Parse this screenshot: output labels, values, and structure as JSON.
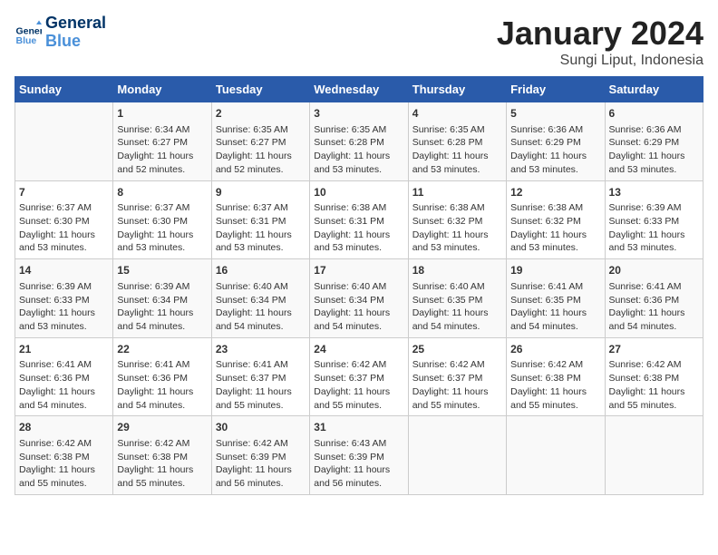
{
  "header": {
    "logo_line1": "General",
    "logo_line2": "Blue",
    "title": "January 2024",
    "subtitle": "Sungi Liput, Indonesia"
  },
  "days_of_week": [
    "Sunday",
    "Monday",
    "Tuesday",
    "Wednesday",
    "Thursday",
    "Friday",
    "Saturday"
  ],
  "weeks": [
    [
      {
        "day": "",
        "content": ""
      },
      {
        "day": "1",
        "content": "Sunrise: 6:34 AM\nSunset: 6:27 PM\nDaylight: 11 hours\nand 52 minutes."
      },
      {
        "day": "2",
        "content": "Sunrise: 6:35 AM\nSunset: 6:27 PM\nDaylight: 11 hours\nand 52 minutes."
      },
      {
        "day": "3",
        "content": "Sunrise: 6:35 AM\nSunset: 6:28 PM\nDaylight: 11 hours\nand 53 minutes."
      },
      {
        "day": "4",
        "content": "Sunrise: 6:35 AM\nSunset: 6:28 PM\nDaylight: 11 hours\nand 53 minutes."
      },
      {
        "day": "5",
        "content": "Sunrise: 6:36 AM\nSunset: 6:29 PM\nDaylight: 11 hours\nand 53 minutes."
      },
      {
        "day": "6",
        "content": "Sunrise: 6:36 AM\nSunset: 6:29 PM\nDaylight: 11 hours\nand 53 minutes."
      }
    ],
    [
      {
        "day": "7",
        "content": "Sunrise: 6:37 AM\nSunset: 6:30 PM\nDaylight: 11 hours\nand 53 minutes."
      },
      {
        "day": "8",
        "content": "Sunrise: 6:37 AM\nSunset: 6:30 PM\nDaylight: 11 hours\nand 53 minutes."
      },
      {
        "day": "9",
        "content": "Sunrise: 6:37 AM\nSunset: 6:31 PM\nDaylight: 11 hours\nand 53 minutes."
      },
      {
        "day": "10",
        "content": "Sunrise: 6:38 AM\nSunset: 6:31 PM\nDaylight: 11 hours\nand 53 minutes."
      },
      {
        "day": "11",
        "content": "Sunrise: 6:38 AM\nSunset: 6:32 PM\nDaylight: 11 hours\nand 53 minutes."
      },
      {
        "day": "12",
        "content": "Sunrise: 6:38 AM\nSunset: 6:32 PM\nDaylight: 11 hours\nand 53 minutes."
      },
      {
        "day": "13",
        "content": "Sunrise: 6:39 AM\nSunset: 6:33 PM\nDaylight: 11 hours\nand 53 minutes."
      }
    ],
    [
      {
        "day": "14",
        "content": "Sunrise: 6:39 AM\nSunset: 6:33 PM\nDaylight: 11 hours\nand 53 minutes."
      },
      {
        "day": "15",
        "content": "Sunrise: 6:39 AM\nSunset: 6:34 PM\nDaylight: 11 hours\nand 54 minutes."
      },
      {
        "day": "16",
        "content": "Sunrise: 6:40 AM\nSunset: 6:34 PM\nDaylight: 11 hours\nand 54 minutes."
      },
      {
        "day": "17",
        "content": "Sunrise: 6:40 AM\nSunset: 6:34 PM\nDaylight: 11 hours\nand 54 minutes."
      },
      {
        "day": "18",
        "content": "Sunrise: 6:40 AM\nSunset: 6:35 PM\nDaylight: 11 hours\nand 54 minutes."
      },
      {
        "day": "19",
        "content": "Sunrise: 6:41 AM\nSunset: 6:35 PM\nDaylight: 11 hours\nand 54 minutes."
      },
      {
        "day": "20",
        "content": "Sunrise: 6:41 AM\nSunset: 6:36 PM\nDaylight: 11 hours\nand 54 minutes."
      }
    ],
    [
      {
        "day": "21",
        "content": "Sunrise: 6:41 AM\nSunset: 6:36 PM\nDaylight: 11 hours\nand 54 minutes."
      },
      {
        "day": "22",
        "content": "Sunrise: 6:41 AM\nSunset: 6:36 PM\nDaylight: 11 hours\nand 54 minutes."
      },
      {
        "day": "23",
        "content": "Sunrise: 6:41 AM\nSunset: 6:37 PM\nDaylight: 11 hours\nand 55 minutes."
      },
      {
        "day": "24",
        "content": "Sunrise: 6:42 AM\nSunset: 6:37 PM\nDaylight: 11 hours\nand 55 minutes."
      },
      {
        "day": "25",
        "content": "Sunrise: 6:42 AM\nSunset: 6:37 PM\nDaylight: 11 hours\nand 55 minutes."
      },
      {
        "day": "26",
        "content": "Sunrise: 6:42 AM\nSunset: 6:38 PM\nDaylight: 11 hours\nand 55 minutes."
      },
      {
        "day": "27",
        "content": "Sunrise: 6:42 AM\nSunset: 6:38 PM\nDaylight: 11 hours\nand 55 minutes."
      }
    ],
    [
      {
        "day": "28",
        "content": "Sunrise: 6:42 AM\nSunset: 6:38 PM\nDaylight: 11 hours\nand 55 minutes."
      },
      {
        "day": "29",
        "content": "Sunrise: 6:42 AM\nSunset: 6:38 PM\nDaylight: 11 hours\nand 55 minutes."
      },
      {
        "day": "30",
        "content": "Sunrise: 6:42 AM\nSunset: 6:39 PM\nDaylight: 11 hours\nand 56 minutes."
      },
      {
        "day": "31",
        "content": "Sunrise: 6:43 AM\nSunset: 6:39 PM\nDaylight: 11 hours\nand 56 minutes."
      },
      {
        "day": "",
        "content": ""
      },
      {
        "day": "",
        "content": ""
      },
      {
        "day": "",
        "content": ""
      }
    ]
  ]
}
